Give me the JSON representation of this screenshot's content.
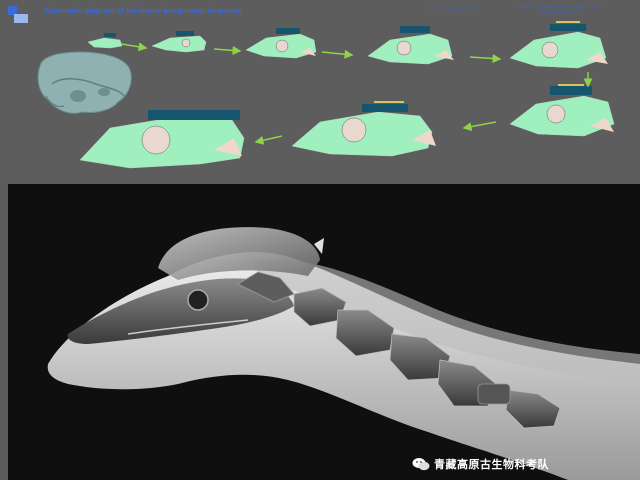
{
  "header": {
    "title": "Schematic diagram of the horny integument formation"
  },
  "annotations": {
    "note_one": "Initial horny (keratin) plate",
    "note_two": "Additional keratin tissue is added on top of the inner horny layer"
  },
  "watermark": {
    "text": "青藏高原古生物科考队"
  },
  "colors": {
    "integument_green": "#9fefbf",
    "horn_navy": "#16556e",
    "growth_yellow": "#d8c45a",
    "title_blue": "#3a6bd6",
    "background_grey": "#5d5d5d"
  }
}
